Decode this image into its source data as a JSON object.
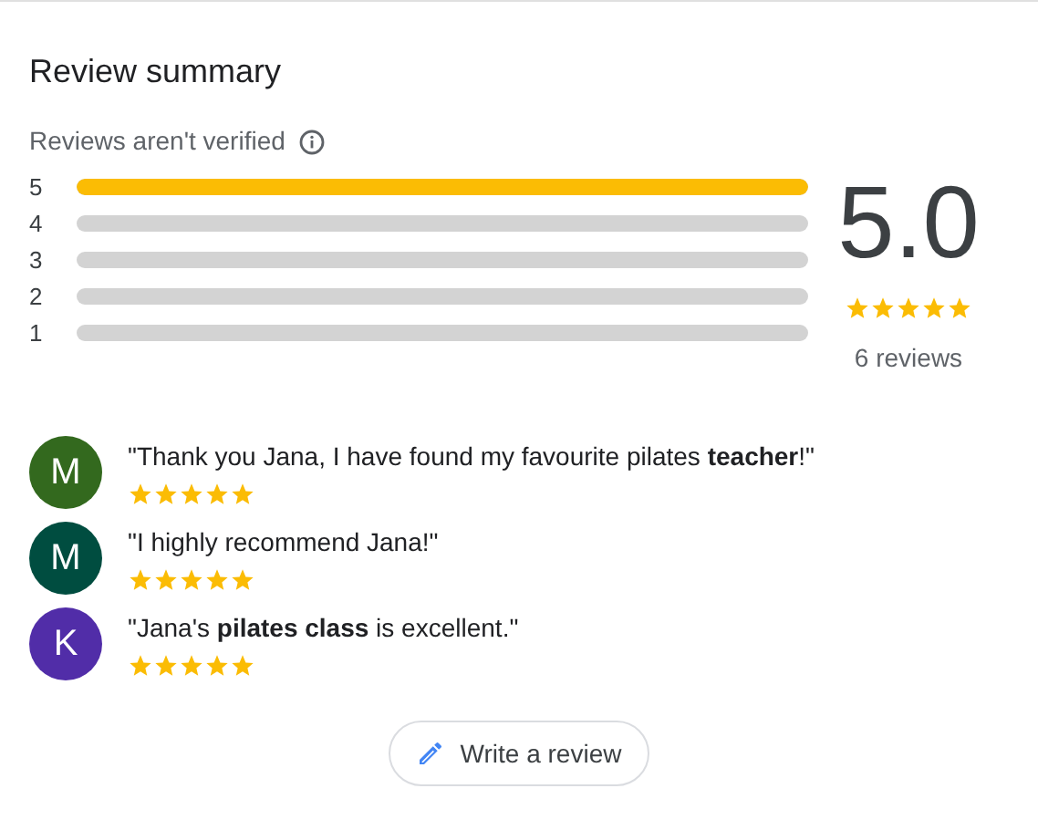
{
  "title": "Review summary",
  "notice": {
    "text": "Reviews aren't verified"
  },
  "distribution": [
    {
      "label": "5",
      "level": 1
    },
    {
      "label": "4",
      "level": 0
    },
    {
      "label": "3",
      "level": 0
    },
    {
      "label": "2",
      "level": 0
    },
    {
      "label": "1",
      "level": 0
    }
  ],
  "rating": {
    "value": "5.0",
    "stars": 5,
    "count": "6 reviews"
  },
  "reviews": [
    {
      "initial": "M",
      "color": "#33691e",
      "text": "\"Thank you Jana, I have found my favourite pilates **teacher**!\"",
      "stars": 5
    },
    {
      "initial": "M",
      "color": "#004d40",
      "text": "\"I highly recommend Jana!\"",
      "stars": 5
    },
    {
      "initial": "K",
      "color": "#512da8",
      "text": "\"Jana's **pilates class** is excellent.\"",
      "stars": 5
    }
  ],
  "button": {
    "label": "Write a review"
  }
}
